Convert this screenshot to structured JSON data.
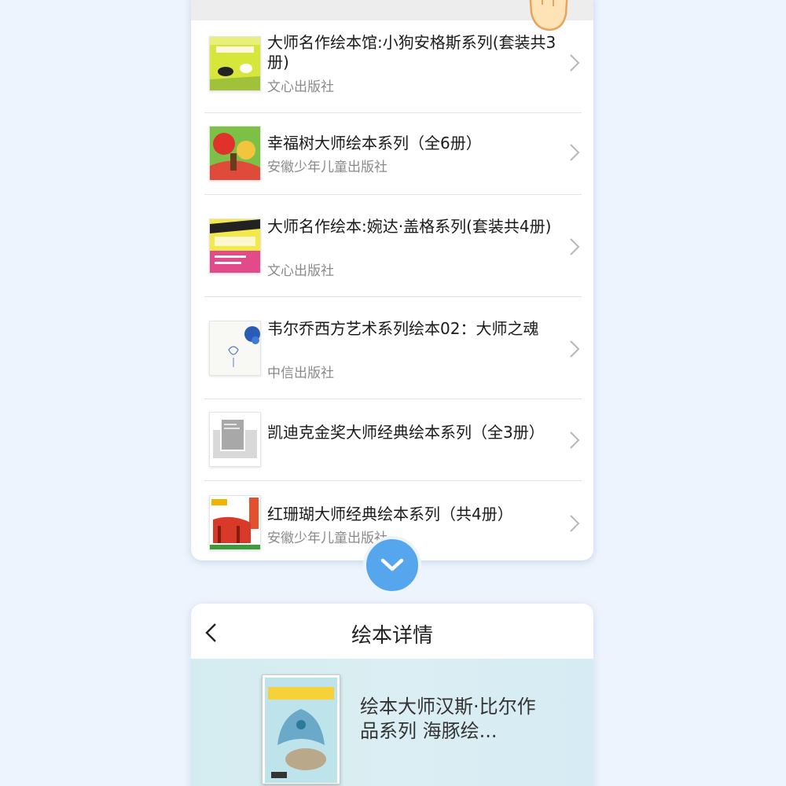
{
  "book_list": {
    "items": [
      {
        "title": "大师名作绘本馆:小狗安格斯系列(套装共3册)",
        "publisher": "文心出版社"
      },
      {
        "title": "幸福树大师绘本系列（全6册）",
        "publisher": "安徽少年儿童出版社"
      },
      {
        "title": "大师名作绘本:婉达·盖格系列(套装共4册)",
        "publisher": "文心出版社"
      },
      {
        "title": "韦尔乔西方艺术系列绘本02：大师之魂",
        "publisher": "中信出版社"
      },
      {
        "title": "凯迪克金奖大师经典绘本系列（全3册）",
        "publisher": ""
      },
      {
        "title": "红珊瑚大师经典绘本系列（共4册）",
        "publisher": "安徽少年儿童出版社"
      }
    ]
  },
  "detail": {
    "header_title": "绘本详情",
    "book_title": "绘本大师汉斯·比尔作品系列 海豚绘..."
  },
  "colors": {
    "background": "#eef4fd",
    "accent": "#56a6ee"
  }
}
